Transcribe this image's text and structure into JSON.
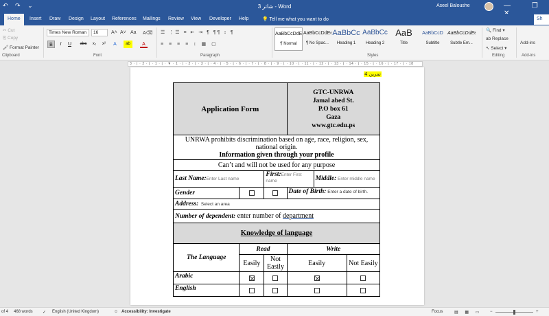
{
  "titlebar": {
    "quick_access": "↶ ↷ ⌄",
    "document_title": "شاتر 3 - Word",
    "user_name": "Aseel Baloushe",
    "window_controls": "— ❐ ✕"
  },
  "tabs": [
    {
      "label": "Home",
      "active": true
    },
    {
      "label": "Insert"
    },
    {
      "label": "Draw"
    },
    {
      "label": "Design"
    },
    {
      "label": "Layout"
    },
    {
      "label": "References"
    },
    {
      "label": "Mailings"
    },
    {
      "label": "Review"
    },
    {
      "label": "View"
    },
    {
      "label": "Developer"
    },
    {
      "label": "Help"
    }
  ],
  "tell_me": "💡 Tell me what you want to do",
  "share_label": "Sh",
  "clipboard": {
    "paste_label": "Paste",
    "cut": "✂ Cut",
    "copy": "⎘ Copy",
    "format_painter": "🖌 Format Painter",
    "group_label": "Clipboard"
  },
  "font": {
    "font_name": "Times New Roman",
    "font_size": "16",
    "bold": "B",
    "italic": "I",
    "underline": "U",
    "strike": "abc",
    "subscript": "x₂",
    "superscript": "x²",
    "grow": "A˄",
    "shrink": "A˅",
    "case": "Aa",
    "clear": "A⌫",
    "effects": "A",
    "highlight": "ab",
    "color": "A",
    "group_label": "Font"
  },
  "paragraph": {
    "row1": "☰ ⋮☰ ≡ ⇤ ⇥ ¶ ¶¶ ↕ ¶",
    "row2": "≡ ≡ ≡ ≡ ↕ ▦ ▢",
    "group_label": "Paragraph"
  },
  "styles": {
    "items": [
      {
        "sample": "AaBbCcDdEe",
        "name": "¶ Normal",
        "selected": true
      },
      {
        "sample": "AaBbCcDdEe",
        "name": "¶ No Spac..."
      },
      {
        "sample": "AaBbCc",
        "name": "Heading 1"
      },
      {
        "sample": "AaBbCc",
        "name": "Heading 2"
      },
      {
        "sample": "AaB",
        "name": "Title"
      },
      {
        "sample": "AaBbCcD",
        "name": "Subtitle"
      },
      {
        "sample": "AaBbCcDdEe",
        "name": "Subtle Em..."
      }
    ],
    "group_label": "Styles"
  },
  "editing": {
    "find": "🔍 Find ▾",
    "replace": "ab Replace",
    "select": "↖ Select ▾",
    "group_label": "Editing"
  },
  "addins": {
    "label": "Add-ins",
    "group_label": "Add-ins"
  },
  "ruler_text": "3 · ⌊ · 2 · ⌊ · 1 · ⌊ · ▼ · 1 · ⌊ · 2 · ⌊ · 3 · ⌊ · 4 · ⌊ · 5 · ⌊ · 6 · ⌊ · 7 · ⌊ · 8 · ⌊ · 9 · ⌊ · 10 · ⌊ · 11 · ⌊ · 12 · ⌊ · 13 · ⌊ · 14 · ⌊ · 15 · ⌊ · 16 · ⌊ · 17 · ⌊ · 18",
  "document": {
    "rtl_heading": "تمرين 4",
    "form_title": "Application Form",
    "org_lines": [
      "GTC-UNRWA",
      "Jamal abed St.",
      "P.O box 61",
      "Gaza",
      "www.gtc.edu.ps"
    ],
    "policy_text": "UNRWA prohibits discrimination based on age, race, religion, sex, national origin.",
    "info_text": "Information given through your profile",
    "cant_text": "Can’t and will not be used for any purpose",
    "last_name_label": "Last Name",
    "last_name_placeholder": "Enter Last name",
    "first_label": "First",
    "first_placeholder": "Enter First name",
    "middle_label": "Middle",
    "middle_placeholder": "Enter middle name",
    "gender_label": "Gender",
    "dob_label": "Date of Birth",
    "dob_placeholder": "Enter a date of birth.",
    "address_label": "Address",
    "address_placeholder": "Select an area",
    "dependents_label": "Number of dependent",
    "dependents_value_prefix": "enter number of ",
    "dependents_value_link": "department",
    "knowledge_title": "Knowledge of language",
    "language_header": "The Language",
    "read_header": "Read",
    "write_header": "Write",
    "easily": "Easily",
    "not_easily": "Not Easily",
    "languages": [
      {
        "name": "Arabic",
        "read_easily": true,
        "read_not_easily": false,
        "write_easily": true,
        "write_not_easily": false
      },
      {
        "name": "English",
        "read_easily": false,
        "read_not_easily": false,
        "write_easily": false,
        "write_not_easily": false
      }
    ]
  },
  "statusbar": {
    "page": "of 4",
    "words": "468 words",
    "language": "English (United Kingdom)",
    "accessibility": "Accessibility: Investigate",
    "focus": "Focus",
    "views": "▤ ▦ ▭",
    "zoom_minus": "−",
    "zoom_plus": "+"
  }
}
